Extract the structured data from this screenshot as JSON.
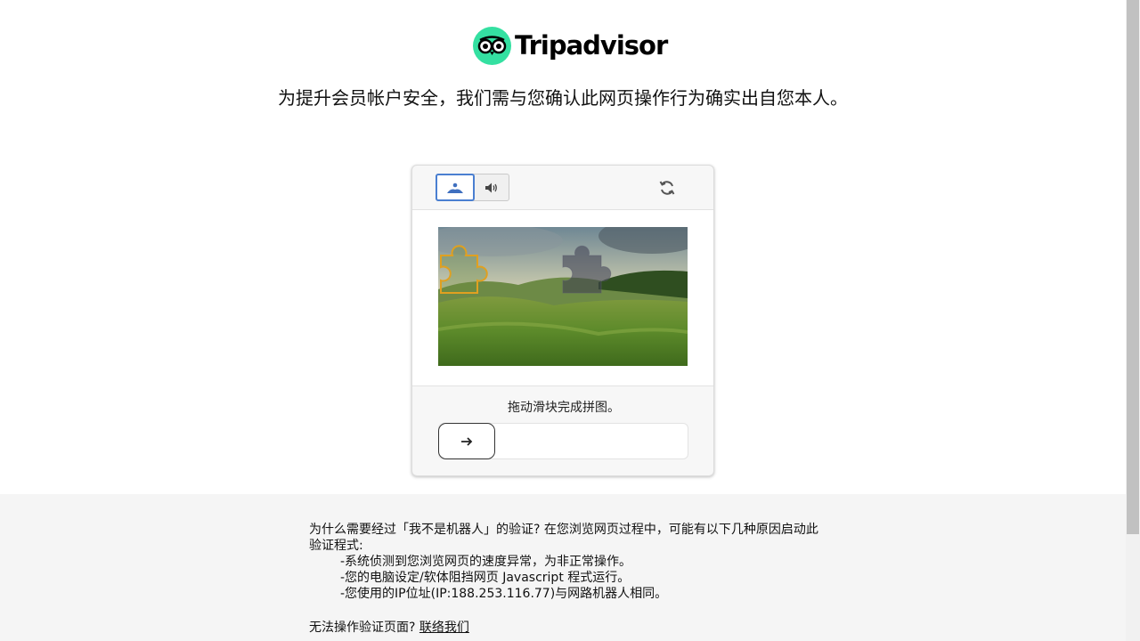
{
  "brand": {
    "name": "Tripadvisor",
    "accent_color": "#34e0a1",
    "logo_icon": "tripadvisor-owl-icon"
  },
  "headline": "为提升会员帐户安全，我们需与您确认此网页操作行为确实出自您本人。",
  "captcha": {
    "modes": [
      {
        "name": "image-mode",
        "icon": "image-icon",
        "active": true
      },
      {
        "name": "audio-mode",
        "icon": "speaker-icon",
        "active": false
      }
    ],
    "refresh_icon": "refresh-icon",
    "instruction": "拖动滑块完成拼图。",
    "slider_icon": "arrow-right-icon",
    "active_color": "#4a7fd1"
  },
  "footer": {
    "intro": "为什么需要经过「我不是机器人」的验证? 在您浏览网页过程中，可能有以下几种原因启动此验证程式:",
    "reasons": [
      "-系统侦测到您浏览网页的速度异常，为非正常操作。",
      "-您的电脑设定/软体阻挡网页 Javascript 程式运行。",
      "-您使用的IP位址(IP:188.253.116.77)与网路机器人相同。"
    ],
    "help_text": "无法操作验证页面? ",
    "contact_link": "联络我们"
  }
}
